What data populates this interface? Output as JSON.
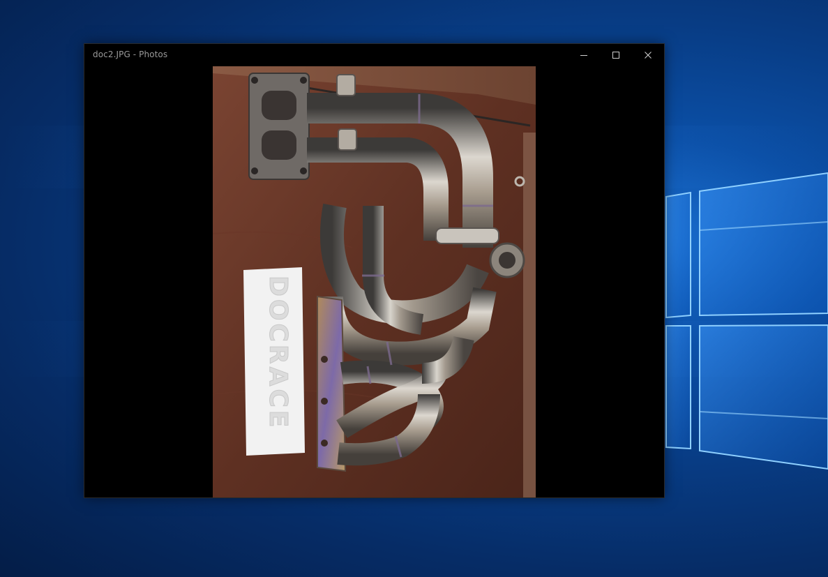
{
  "window": {
    "title": "doc2.JPG - Photos",
    "buttons": {
      "minimize": "minimize",
      "maximize": "maximize",
      "close": "close"
    }
  },
  "photo": {
    "sticker_text": "DOCRACE"
  },
  "icons": {
    "minimize": "minimize-icon",
    "maximize": "maximize-icon",
    "close": "close-icon",
    "wallpaper_logo": "windows-logo-icon"
  },
  "colors": {
    "titlebar": "#000000",
    "title_text": "#9a9a9a",
    "wood": "#6e3a2a",
    "steel": "#b7b2a9",
    "desktop_blue": "#0b4fa6"
  }
}
